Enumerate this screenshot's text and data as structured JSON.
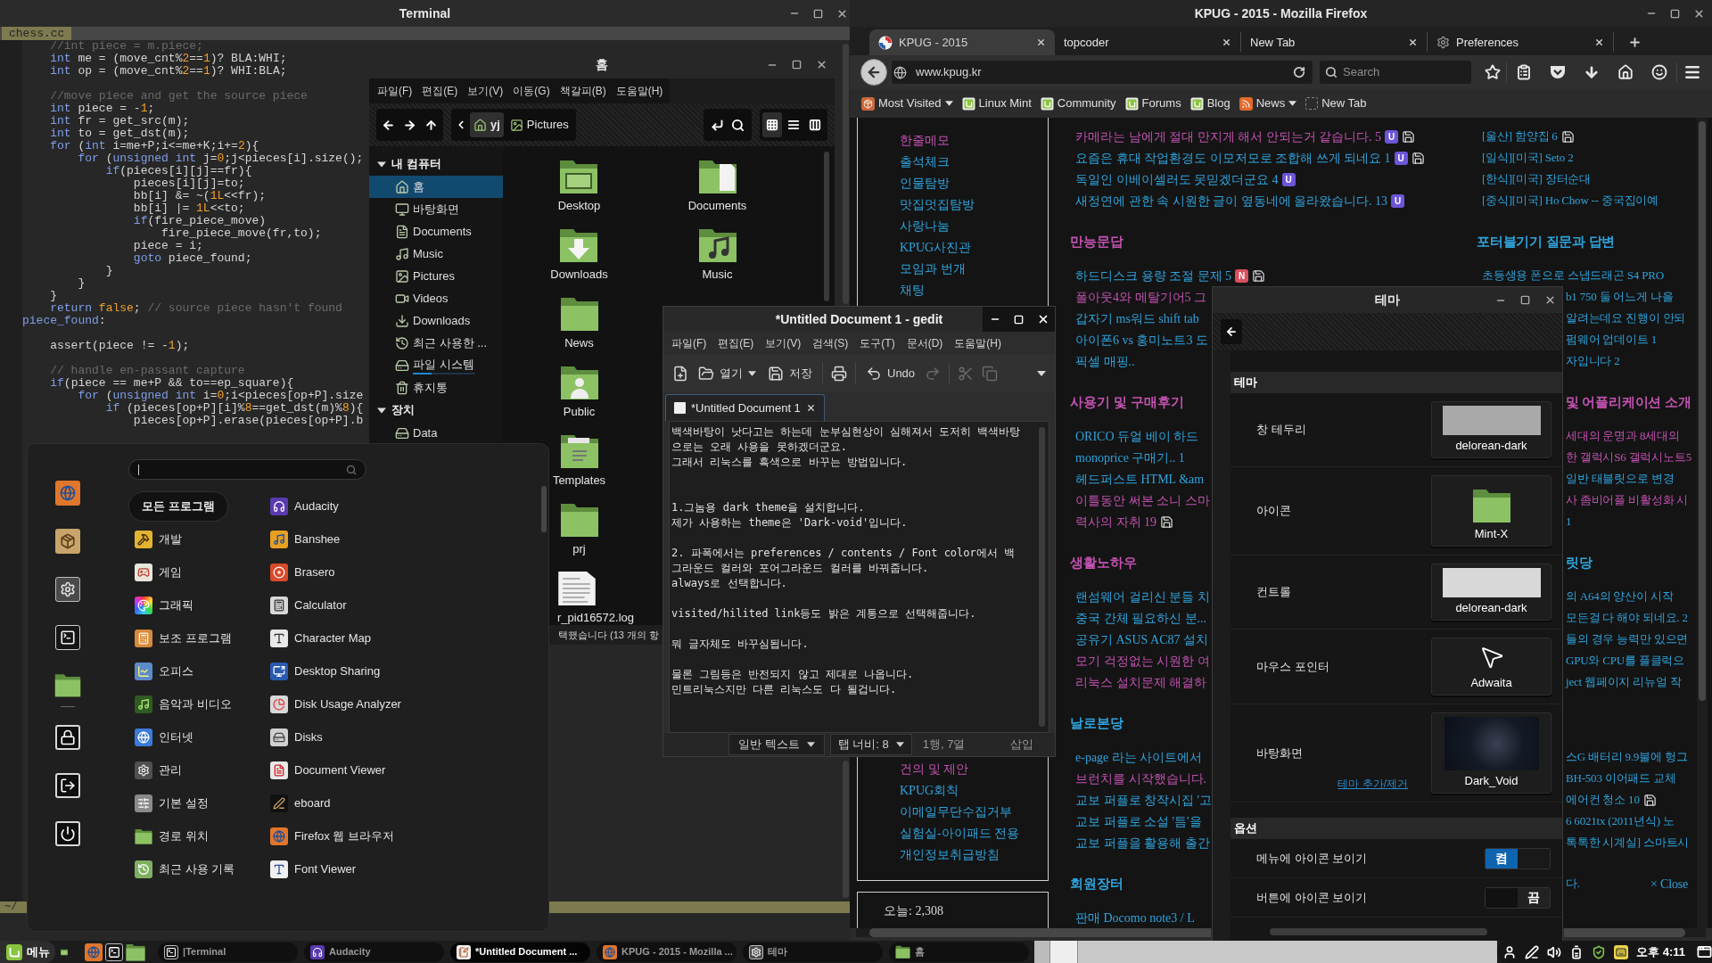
{
  "terminal": {
    "title": "Terminal",
    "tab": "chess.cc",
    "status": "~/",
    "code_lines": [
      {
        "kind": "code",
        "segments": [
          {
            "kind": "comment",
            "text": "    //int piece = m.piece;"
          }
        ]
      },
      {
        "kind": "code",
        "segments": [
          {
            "kind": "keyword",
            "text": "    int"
          },
          {
            "kind": "plain",
            "text": " me = (move_cnt%"
          },
          {
            "kind": "number",
            "text": "2"
          },
          {
            "kind": "plain",
            "text": "=="
          },
          {
            "kind": "number",
            "text": "1"
          },
          {
            "kind": "plain",
            "text": ")? BLA:WHI;"
          }
        ]
      },
      {
        "kind": "code",
        "segments": [
          {
            "kind": "keyword",
            "text": "    int"
          },
          {
            "kind": "plain",
            "text": " op = (move_cnt%"
          },
          {
            "kind": "number",
            "text": "2"
          },
          {
            "kind": "plain",
            "text": "=="
          },
          {
            "kind": "number",
            "text": "1"
          },
          {
            "kind": "plain",
            "text": ")? WHI:BLA;"
          }
        ]
      },
      {
        "kind": "blank"
      },
      {
        "kind": "code",
        "segments": [
          {
            "kind": "comment",
            "text": "    //move piece and get the source piece"
          }
        ]
      },
      {
        "kind": "code",
        "segments": [
          {
            "kind": "keyword",
            "text": "    int"
          },
          {
            "kind": "plain",
            "text": " piece = -"
          },
          {
            "kind": "number",
            "text": "1"
          },
          {
            "kind": "plain",
            "text": ";"
          }
        ]
      },
      {
        "kind": "code",
        "segments": [
          {
            "kind": "keyword",
            "text": "    int"
          },
          {
            "kind": "plain",
            "text": " fr = get_src(m);"
          }
        ]
      },
      {
        "kind": "code",
        "segments": [
          {
            "kind": "keyword",
            "text": "    int"
          },
          {
            "kind": "plain",
            "text": " to = get_dst(m);"
          }
        ]
      },
      {
        "kind": "code",
        "segments": [
          {
            "kind": "keyword",
            "text": "    for"
          },
          {
            "kind": "plain",
            "text": " ("
          },
          {
            "kind": "keyword",
            "text": "int"
          },
          {
            "kind": "plain",
            "text": " i=me+P;i<=me+K;i+="
          },
          {
            "kind": "number",
            "text": "2"
          },
          {
            "kind": "plain",
            "text": "){"
          }
        ]
      },
      {
        "kind": "code",
        "segments": [
          {
            "kind": "keyword",
            "text": "        for"
          },
          {
            "kind": "plain",
            "text": " ("
          },
          {
            "kind": "keyword",
            "text": "unsigned int"
          },
          {
            "kind": "plain",
            "text": " j="
          },
          {
            "kind": "number",
            "text": "0"
          },
          {
            "kind": "plain",
            "text": ";j<pieces[i].size();"
          }
        ]
      },
      {
        "kind": "code",
        "segments": [
          {
            "kind": "keyword",
            "text": "            if"
          },
          {
            "kind": "plain",
            "text": "(pieces[i][j]==fr){"
          }
        ]
      },
      {
        "kind": "code",
        "segments": [
          {
            "kind": "plain",
            "text": "                pieces[i][j]=to;"
          }
        ]
      },
      {
        "kind": "code",
        "segments": [
          {
            "kind": "plain",
            "text": "                bb[i] &= ~("
          },
          {
            "kind": "number",
            "text": "1L"
          },
          {
            "kind": "plain",
            "text": "<<fr);"
          }
        ]
      },
      {
        "kind": "code",
        "segments": [
          {
            "kind": "plain",
            "text": "                bb[i] |= "
          },
          {
            "kind": "number",
            "text": "1L"
          },
          {
            "kind": "plain",
            "text": "<<to;"
          }
        ]
      },
      {
        "kind": "code",
        "segments": [
          {
            "kind": "keyword",
            "text": "                if"
          },
          {
            "kind": "plain",
            "text": "(fire_piece_move)"
          }
        ]
      },
      {
        "kind": "code",
        "segments": [
          {
            "kind": "plain",
            "text": "                    fire_piece_move(fr,to);"
          }
        ]
      },
      {
        "kind": "code",
        "segments": [
          {
            "kind": "plain",
            "text": "                piece = i;"
          }
        ]
      },
      {
        "kind": "code",
        "segments": [
          {
            "kind": "keyword",
            "text": "                goto"
          },
          {
            "kind": "plain",
            "text": " piece_found;"
          }
        ]
      },
      {
        "kind": "code",
        "segments": [
          {
            "kind": "plain",
            "text": "            }"
          }
        ]
      },
      {
        "kind": "code",
        "segments": [
          {
            "kind": "plain",
            "text": "        }"
          }
        ]
      },
      {
        "kind": "code",
        "segments": [
          {
            "kind": "plain",
            "text": "    }"
          }
        ]
      },
      {
        "kind": "code",
        "segments": [
          {
            "kind": "keyword",
            "text": "    return "
          },
          {
            "kind": "number",
            "text": "false"
          },
          {
            "kind": "plain",
            "text": ";"
          },
          {
            "kind": "comment",
            "text": " // source piece hasn't found"
          }
        ]
      },
      {
        "kind": "code",
        "segments": [
          {
            "kind": "keyword",
            "text": "piece_found"
          },
          {
            "kind": "plain",
            "text": ":"
          }
        ]
      },
      {
        "kind": "blank"
      },
      {
        "kind": "code",
        "segments": [
          {
            "kind": "plain",
            "text": "    assert(piece != -"
          },
          {
            "kind": "number",
            "text": "1"
          },
          {
            "kind": "plain",
            "text": ");"
          }
        ]
      },
      {
        "kind": "blank"
      },
      {
        "kind": "code",
        "segments": [
          {
            "kind": "comment",
            "text": "    // handle en-passant capture"
          }
        ]
      },
      {
        "kind": "code",
        "segments": [
          {
            "kind": "keyword",
            "text": "    if"
          },
          {
            "kind": "plain",
            "text": "(piece == me+P && to==ep_square){"
          }
        ]
      },
      {
        "kind": "code",
        "segments": [
          {
            "kind": "keyword",
            "text": "        for"
          },
          {
            "kind": "plain",
            "text": " ("
          },
          {
            "kind": "keyword",
            "text": "unsigned int"
          },
          {
            "kind": "plain",
            "text": " i="
          },
          {
            "kind": "number",
            "text": "0"
          },
          {
            "kind": "plain",
            "text": ";i<pieces[op+P].size"
          }
        ]
      },
      {
        "kind": "code",
        "segments": [
          {
            "kind": "keyword",
            "text": "            if"
          },
          {
            "kind": "plain",
            "text": " (pieces[op+P][i]%"
          },
          {
            "kind": "number",
            "text": "8"
          },
          {
            "kind": "plain",
            "text": "==get_dst(m)%"
          },
          {
            "kind": "number",
            "text": "8"
          },
          {
            "kind": "plain",
            "text": "){"
          }
        ]
      },
      {
        "kind": "code",
        "segments": [
          {
            "kind": "plain",
            "text": "                pieces[op+P].erase(pieces[op+P].b"
          }
        ]
      }
    ]
  },
  "file_manager": {
    "title": "홈",
    "menu": [
      "파일(F)",
      "편집(E)",
      "보기(V)",
      "이동(G)",
      "책갈피(B)",
      "도움말(H)"
    ],
    "path": [
      {
        "label": "yj",
        "selected": true
      },
      {
        "label": "Pictures",
        "selected": false
      }
    ],
    "views": [
      {
        "kind": "icons",
        "selected": true
      },
      {
        "kind": "list",
        "selected": false
      },
      {
        "kind": "compact",
        "selected": false
      }
    ],
    "sidebar": [
      {
        "heading": "내 컴퓨터",
        "expanded": true,
        "items": [
          {
            "label": "홈",
            "kind": "home",
            "selected": true
          },
          {
            "label": "바탕화면",
            "kind": "desktop",
            "selected": false
          },
          {
            "label": "Documents",
            "kind": "documents",
            "selected": false
          },
          {
            "label": "Music",
            "kind": "music",
            "selected": false
          },
          {
            "label": "Pictures",
            "kind": "pictures",
            "selected": false
          },
          {
            "label": "Videos",
            "kind": "videos",
            "selected": false
          },
          {
            "label": "Downloads",
            "kind": "downloads",
            "selected": false
          },
          {
            "label": "최근 사용한 ...",
            "kind": "recent",
            "selected": false
          },
          {
            "label": "파일 시스템",
            "kind": "filesystem",
            "selected": false,
            "level": 0.3
          },
          {
            "label": "휴지통",
            "kind": "trash",
            "selected": false
          }
        ]
      },
      {
        "heading": "장치",
        "expanded": true,
        "items": [
          {
            "label": "Data",
            "kind": "drive",
            "selected": false
          }
        ]
      }
    ],
    "files": [
      {
        "name": "Desktop",
        "kind": "desktop"
      },
      {
        "name": "Documents",
        "kind": "documents"
      },
      {
        "name": "Downloads",
        "kind": "downloads"
      },
      {
        "name": "Music",
        "kind": "music"
      },
      {
        "name": "News",
        "kind": "folder"
      },
      {
        "name": "Public",
        "kind": "public"
      },
      {
        "name": "Templates",
        "kind": "templates"
      },
      {
        "name": "prj",
        "kind": "folder"
      },
      {
        "name": "r_pid16572.log",
        "kind": "text"
      }
    ],
    "status": "택했습니다 (13 개의 항"
  },
  "gedit": {
    "title": "*Untitled Document 1 - gedit",
    "menu": [
      "파일(F)",
      "편집(E)",
      "보기(V)",
      "검색(S)",
      "도구(T)",
      "문서(D)",
      "도움말(H)"
    ],
    "toolbar": [
      {
        "kind": "new",
        "disabled": false
      },
      {
        "kind": "open",
        "label": "열기",
        "disabled": false
      },
      {
        "kind": "save",
        "label": "저장",
        "disabled": false
      },
      {
        "kind": "print",
        "disabled": false
      },
      {
        "kind": "undo",
        "label": "Undo",
        "disabled": false
      },
      {
        "kind": "redo",
        "disabled": true
      },
      {
        "kind": "cut",
        "disabled": true
      },
      {
        "kind": "copy",
        "disabled": true
      }
    ],
    "tab": "*Untitled Document 1",
    "text_lines": [
      {
        "kind": "text",
        "text": "백색바탕이 낫다고는 하는데 눈부심현상이 심해져서 도저히 백색바탕"
      },
      {
        "kind": "text",
        "text": "으로는 오래 사용을 못하겠더군요."
      },
      {
        "kind": "text",
        "text": "그래서 리눅스를 흑색으로 바꾸는 방법입니다."
      },
      {
        "kind": "blank"
      },
      {
        "kind": "blank"
      },
      {
        "kind": "text",
        "text": "1.그놈용 dark theme을 설치합니다."
      },
      {
        "kind": "text",
        "text": "제가 사용하는 theme은 'Dark-void'입니다."
      },
      {
        "kind": "blank"
      },
      {
        "kind": "text",
        "text": "2. 파폭에서는 preferences / contents / Font color에서 백"
      },
      {
        "kind": "text",
        "text": "그라운드 컬러와 포어그라운드 컬러를 바꿔줍니다."
      },
      {
        "kind": "text",
        "text": "always로 선택합니다."
      },
      {
        "kind": "blank"
      },
      {
        "kind": "text",
        "text": "visited/hilited link등도 밝은 계통으로 선택해줍니다."
      },
      {
        "kind": "blank"
      },
      {
        "kind": "text",
        "text": "뭐 글자체도 바꾸심됩니다."
      },
      {
        "kind": "blank"
      },
      {
        "kind": "text",
        "text": "물론 그림등은 반전되지 않고 제대로 나옵니다."
      },
      {
        "kind": "text",
        "text": "민트리눅스지만 다른 리눅스도 다 될겁니다."
      }
    ],
    "status": {
      "language": "일반 텍스트",
      "tab_width": "탭 너비: 8",
      "position": "1행, 7열",
      "mode": "삽입"
    }
  },
  "firefox": {
    "title": "KPUG - 2015 - Mozilla Firefox",
    "tabs": [
      {
        "label": "KPUG - 2015",
        "kind": "site",
        "selected": true
      },
      {
        "label": "topcoder",
        "kind": "blank",
        "selected": false
      },
      {
        "label": "New Tab",
        "kind": "blank",
        "selected": false
      },
      {
        "label": "Preferences",
        "kind": "settings",
        "selected": false
      }
    ],
    "url": "www.kpug.kr",
    "search_placeholder": "Search",
    "bookmarks": [
      {
        "label": "Most Visited",
        "kind": "folder",
        "dropdown": true
      },
      {
        "label": "Linux Mint",
        "kind": "site",
        "dropdown": false
      },
      {
        "label": "Community",
        "kind": "site",
        "dropdown": false
      },
      {
        "label": "Forums",
        "kind": "site",
        "dropdown": false
      },
      {
        "label": "Blog",
        "kind": "site",
        "dropdown": false
      },
      {
        "label": "News",
        "kind": "feed",
        "dropdown": true
      },
      {
        "label": "New Tab",
        "kind": "blank",
        "dropdown": false
      }
    ],
    "page": {
      "nav_groups": [
        {
          "links": [
            {
              "text": "한줄메모",
              "visited": true
            },
            {
              "text": "출석체크",
              "visited": false
            },
            {
              "text": "인물탐방",
              "visited": false
            },
            {
              "text": "맛집멋집탐방",
              "visited": false
            },
            {
              "text": "사랑나눔",
              "visited": false
            },
            {
              "text": "KPUG사진관",
              "visited": false
            },
            {
              "text": "모임과 번개",
              "visited": false
            },
            {
              "text": "채팅",
              "visited": false
            }
          ]
        },
        {
          "links": [
            {
              "text": "건의 및 제안",
              "visited": true
            },
            {
              "text": "KPUG회칙",
              "visited": false
            },
            {
              "text": "이메일무단수집거부",
              "visited": false
            },
            {
              "text": "실험실-아이패드 전용",
              "visited": false
            },
            {
              "text": "개인정보취급방침",
              "visited": false
            }
          ]
        }
      ],
      "visitor_count": "오늘: 2,308",
      "middle_sections": [
        {
          "links": [
            {
              "text": "카메라는 남에게 절대 만지게 해서 안되는거 같습니다. 5",
              "visited": true,
              "attachment": true,
              "badge": {
                "label": "U",
                "color": "#6d55d8"
              }
            },
            {
              "text": "요즘은 휴대 작업환경도 이모저모로 조합해 쓰게 되네요 1",
              "visited": false,
              "attachment": true,
              "badge": {
                "label": "U",
                "color": "#6d55d8"
              }
            },
            {
              "text": "독일인 이베이셀러도 못믿겠더군요 4",
              "visited": false,
              "attachment": false,
              "badge": {
                "label": "U",
                "color": "#6d55d8"
              }
            },
            {
              "text": "새정연에 관한 속 시원한 글이 옆동네에 올라왔습니다. 13",
              "visited": false,
              "attachment": false,
              "badge": {
                "label": "U",
                "color": "#6d55d8"
              }
            }
          ]
        },
        {
          "heading": {
            "text": "만능문답",
            "visited": true
          },
          "links": [
            {
              "text": "하드디스크 용량 조절 문제 5",
              "visited": false,
              "attachment": true,
              "badge": {
                "label": "N",
                "color": "#d9505c"
              }
            },
            {
              "text": "폴아웃4와 메탈기어5 그",
              "visited": true,
              "attachment": false
            },
            {
              "text": "갑자기 ms워드 shift tab",
              "visited": false,
              "attachment": false
            },
            {
              "text": "아이폰6 vs 홍미노트3 도",
              "visited": false,
              "attachment": false
            },
            {
              "text": "픽셀 매핑..",
              "visited": false,
              "attachment": false
            }
          ]
        },
        {
          "heading": {
            "text": "사용기 및 구매후기",
            "visited": true
          },
          "links": [
            {
              "text": "ORICO 듀얼 베이 하드",
              "visited": false,
              "attachment": false
            },
            {
              "text": "monoprice 구매기.. 1",
              "visited": false,
              "attachment": false
            },
            {
              "text": "헤드퍼스트 HTML &am",
              "visited": false,
              "attachment": false
            },
            {
              "text": "이틀동안 써본 소니 스마",
              "visited": true,
              "attachment": false
            },
            {
              "text": "력사의 자취 19",
              "visited": true,
              "attachment": true
            }
          ]
        },
        {
          "heading": {
            "text": "생활노하우",
            "visited": true
          },
          "links": [
            {
              "text": "랜섬웨어 걸리신 분들 치",
              "visited": false,
              "attachment": false
            },
            {
              "text": "중국 간체 필요하신 분...",
              "visited": false,
              "attachment": false
            },
            {
              "text": "공유기 ASUS AC87 설치",
              "visited": false,
              "attachment": false
            },
            {
              "text": "모기 걱정없는 시원한 여",
              "visited": true,
              "attachment": false
            },
            {
              "text": "리눅스 설치문제 해결하",
              "visited": true,
              "attachment": false
            }
          ]
        },
        {
          "heading": {
            "text": "날로본당",
            "visited": false
          },
          "links": [
            {
              "text": "e-page 라는 사이트에서",
              "visited": false,
              "attachment": false
            },
            {
              "text": "브런치를 시작했습니다.",
              "visited": true,
              "attachment": false
            },
            {
              "text": "교보 퍼플로 창작시집 '고",
              "visited": false,
              "attachment": false
            },
            {
              "text": "교보 퍼플로 소설 '틈'을",
              "visited": false,
              "attachment": false
            },
            {
              "text": "교보 퍼플을 활용해 출간",
              "visited": false,
              "attachment": false
            }
          ]
        },
        {
          "heading": {
            "text": "회원장터",
            "visited": false
          },
          "links": [
            {
              "text": "판매 Docomo note3 / L",
              "visited": false,
              "attachment": false
            }
          ]
        }
      ],
      "right_sections": [
        {
          "links": [
            {
              "text": "[울산] 함양집 6",
              "visited": false,
              "attachment": true
            },
            {
              "text": "[일식][미국] Seto 2",
              "visited": false,
              "attachment": false
            },
            {
              "text": "[한식][미국] 장터순대",
              "visited": false,
              "attachment": false
            },
            {
              "text": "[중식][미국] Ho Chow -- 중국집이예",
              "visited": false,
              "attachment": false
            }
          ]
        },
        {
          "heading": {
            "text": "포터블기기 질문과 답변",
            "visited": false
          },
          "links": [
            {
              "text": "초등생용 폰으로 스냅드래곤 S4 PRO",
              "visited": false,
              "attachment": false
            },
            {
              "text": "b1 750 둘 어느게 나을",
              "visited": false,
              "attachment": false
            },
            {
              "text": "알려는데요 진행이 안되",
              "visited": false,
              "attachment": false
            },
            {
              "text": "펌웨어 업데이트 1",
              "visited": false,
              "attachment": false
            },
            {
              "text": "자입니다 2",
              "visited": false,
              "attachment": false
            }
          ]
        },
        {
          "heading": {
            "text": "및 어플리케이션 소개",
            "visited": true
          },
          "links": [
            {
              "text": "세대의 운명과 8세대의",
              "visited": true,
              "attachment": false
            },
            {
              "text": "한 갤럭시S6 갤럭시노트5",
              "visited": true,
              "attachment": false
            },
            {
              "text": "일반 태블릿으로 변경",
              "visited": false,
              "attachment": false
            },
            {
              "text": "사 좀비어플 비활성화 시",
              "visited": true,
              "attachment": false
            },
            {
              "text": "1",
              "visited": false,
              "attachment": false
            }
          ]
        },
        {
          "heading": {
            "text": "릿당",
            "visited": false
          },
          "links": [
            {
              "text": "의 A64의 양산이 시작",
              "visited": false,
              "attachment": false
            },
            {
              "text": "모든걸 다 해야 되네요. 2",
              "visited": false,
              "attachment": false
            },
            {
              "text": "들의 경우 능력만 있으면",
              "visited": false,
              "attachment": false
            },
            {
              "text": "GPU와 CPU를 플클럭으",
              "visited": false,
              "attachment": false
            },
            {
              "text": "ject 웹페이지 리뉴얼 작",
              "visited": false,
              "attachment": false
            }
          ]
        },
        {
          "links": [
            {
              "text": "스G 배터리 9.9불에 헝그",
              "visited": false,
              "attachment": false
            },
            {
              "text": "BH-503 이어패드 교체",
              "visited": false,
              "attachment": false
            },
            {
              "text": "에어컨 청소 10",
              "visited": false,
              "attachment": true
            },
            {
              "text": "6 6021tx (2011년식) 노",
              "visited": false,
              "attachment": false
            },
            {
              "text": "톡톡한 시계실] 스마트시",
              "visited": false,
              "attachment": false
            }
          ]
        }
      ],
      "notice": {
        "text": "다.",
        "close": "× Close"
      }
    }
  },
  "theme": {
    "title": "테마",
    "section": "테마",
    "rows": [
      {
        "label": "창 테두리",
        "value": "delorean-dark",
        "kind": "swatch",
        "color": "#a9a9a9"
      },
      {
        "label": "아이콘",
        "value": "Mint-X",
        "kind": "folder"
      },
      {
        "label": "컨트롤",
        "value": "delorean-dark",
        "kind": "swatch",
        "color": "#d8d8d8"
      },
      {
        "label": "마우스 포인터",
        "value": "Adwaita",
        "kind": "cursor"
      },
      {
        "label": "바탕화면",
        "value": "Dark_Void",
        "kind": "wallpaper"
      }
    ],
    "manage_link": "테마 추가/제거",
    "options_title": "옵션",
    "options": [
      {
        "label": "메뉴에 아이콘 보이기",
        "on": true,
        "state": "켬"
      },
      {
        "label": "버튼에 아이콘 보이기",
        "on": false,
        "state": "끔"
      }
    ]
  },
  "menu": {
    "categories": [
      {
        "label": "모든 프로그램",
        "selected": true
      },
      {
        "label": "개발",
        "selected": false
      },
      {
        "label": "게임",
        "selected": false
      },
      {
        "label": "그래픽",
        "selected": false
      },
      {
        "label": "보조 프로그램",
        "selected": false
      },
      {
        "label": "오피스",
        "selected": false
      },
      {
        "label": "음악과 비디오",
        "selected": false
      },
      {
        "label": "인터넷",
        "selected": false
      },
      {
        "label": "관리",
        "selected": false
      },
      {
        "label": "기본 설정",
        "selected": false
      },
      {
        "label": "경로 위치",
        "selected": false
      },
      {
        "label": "최근 사용 기록",
        "selected": false
      }
    ],
    "apps": [
      "Audacity",
      "Banshee",
      "Brasero",
      "Calculator",
      "Character Map",
      "Desktop Sharing",
      "Disk Usage Analyzer",
      "Disks",
      "Document Viewer",
      "eboard",
      "Firefox 웹 브라우저",
      "Font Viewer"
    ]
  },
  "taskbar": {
    "menu_label": "메뉴",
    "windows": [
      {
        "label": "|Terminal",
        "kind": "terminal",
        "selected": false
      },
      {
        "label": "Audacity",
        "kind": "audio",
        "selected": false
      },
      {
        "label": "*Untitled Document ...",
        "kind": "editor",
        "selected": true
      },
      {
        "label": "KPUG - 2015 - Mozilla ...",
        "kind": "browser",
        "selected": false
      },
      {
        "label": "테마",
        "kind": "settings",
        "selected": false
      },
      {
        "label": "홈",
        "kind": "files",
        "selected": false
      }
    ],
    "clock": "오후 4:11"
  }
}
